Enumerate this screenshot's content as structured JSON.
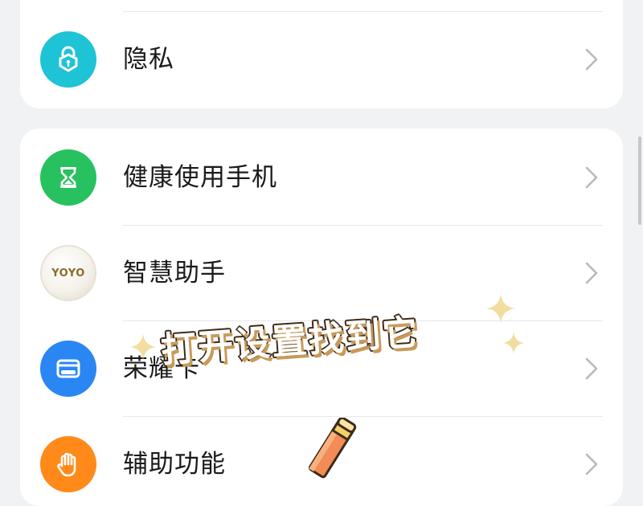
{
  "settings": {
    "top_card": {
      "items": [
        {
          "label": "隐私",
          "icon": "privacy-lock-icon",
          "color": "#1ec3d6"
        }
      ]
    },
    "main_card": {
      "items": [
        {
          "label": "健康使用手机",
          "icon": "hourglass-icon",
          "color": "#27c25f"
        },
        {
          "label": "智慧助手",
          "icon": "yoyo-logo-icon",
          "badge_text": "YOYO"
        },
        {
          "label": "荣耀卡",
          "icon": "wallet-card-icon",
          "color": "#2a86f3"
        },
        {
          "label": "辅助功能",
          "icon": "hand-icon",
          "color": "#ff8a1a"
        }
      ]
    }
  },
  "overlay": {
    "caption": "打开设置找到它"
  },
  "colors": {
    "background": "#f1f2f4",
    "card": "#ffffff",
    "divider": "#e6e7ea",
    "chevron": "#b8b9bd",
    "caption_outline": "#3d2a18",
    "sparkle": "#f3dca0"
  }
}
